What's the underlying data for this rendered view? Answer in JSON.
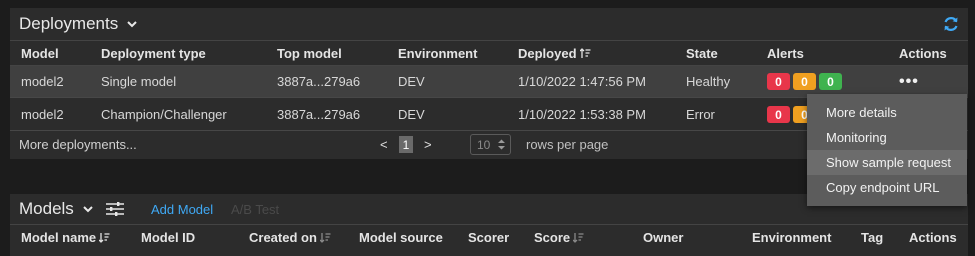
{
  "deployments": {
    "title": "Deployments",
    "columns": [
      "Model",
      "Deployment type",
      "Top model",
      "Environment",
      "Deployed",
      "State",
      "Alerts",
      "Actions"
    ],
    "rows": [
      {
        "model": "model2",
        "type": "Single model",
        "top_model": "3887a...279a6",
        "environment": "DEV",
        "deployed": "1/10/2022 1:47:56 PM",
        "state": "Healthy",
        "alerts": [
          "0",
          "0",
          "0"
        ],
        "actions": "•••"
      },
      {
        "model": "model2",
        "type": "Champion/Challenger",
        "top_model": "3887a...279a6",
        "environment": "DEV",
        "deployed": "1/10/2022 1:53:38 PM",
        "state": "Error",
        "alerts": [
          "0",
          "0"
        ],
        "actions": ""
      }
    ],
    "more_link": "More deployments...",
    "pagination": {
      "prev": "<",
      "page": "1",
      "next": ">",
      "rows_value": "10",
      "rows_label": "rows per page"
    }
  },
  "actions_menu": {
    "items": [
      "More details",
      "Monitoring",
      "Show sample request",
      "Copy endpoint URL"
    ],
    "hovered_index": 2
  },
  "models": {
    "title": "Models",
    "add_model": "Add Model",
    "ab_test": "A/B Test",
    "columns": [
      "Model name",
      "Model ID",
      "Created on",
      "Model source",
      "Scorer",
      "Score",
      "Owner",
      "Environment",
      "Tag",
      "Actions"
    ]
  },
  "colors": {
    "accent": "#3fa9f5",
    "alert_red": "#e8364a",
    "alert_orange": "#f0a020",
    "alert_green": "#3fb34f"
  },
  "icons": [
    "chevron-down-icon",
    "refresh-icon",
    "sort-icon",
    "filter-icon",
    "spinner-icon"
  ]
}
